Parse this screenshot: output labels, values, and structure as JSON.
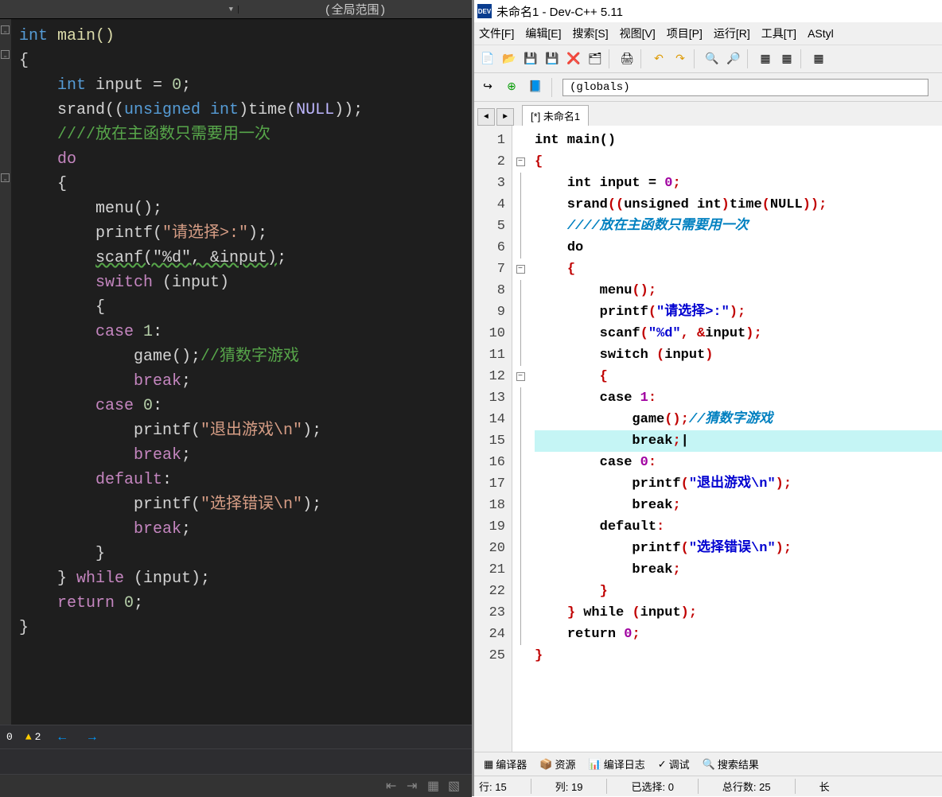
{
  "vs": {
    "top_scope": "(全局范围)",
    "warning_count": "2",
    "status_zero": "0",
    "code": [
      {
        "t": "int",
        "c": "k-type"
      },
      {
        "t": " main()",
        "c": "k-func"
      },
      {
        "nl": 1
      },
      {
        "t": "{",
        "c": "k-white"
      },
      {
        "nl": 1
      },
      {
        "t": "    ",
        "c": ""
      },
      {
        "t": "int",
        "c": "k-type"
      },
      {
        "t": " input = ",
        "c": "k-white"
      },
      {
        "t": "0",
        "c": "k-num"
      },
      {
        "t": ";",
        "c": "k-white"
      },
      {
        "nl": 1
      },
      {
        "t": "    srand((",
        "c": "k-white"
      },
      {
        "t": "unsigned int",
        "c": "k-type"
      },
      {
        "t": ")time(",
        "c": "k-white"
      },
      {
        "t": "NULL",
        "c": "k-macro"
      },
      {
        "t": "));",
        "c": "k-white"
      },
      {
        "nl": 1
      },
      {
        "t": "    ",
        "c": ""
      },
      {
        "t": "////放在主函数只需要用一次",
        "c": "k-comment"
      },
      {
        "nl": 1
      },
      {
        "t": "    ",
        "c": ""
      },
      {
        "t": "do",
        "c": "k-purple"
      },
      {
        "nl": 1
      },
      {
        "t": "    {",
        "c": "k-white"
      },
      {
        "nl": 1
      },
      {
        "t": "        menu();",
        "c": "k-white"
      },
      {
        "nl": 1
      },
      {
        "t": "        printf(",
        "c": "k-white"
      },
      {
        "t": "\"请选择>:\"",
        "c": "k-str"
      },
      {
        "t": ");",
        "c": "k-white"
      },
      {
        "nl": 1
      },
      {
        "t": "        ",
        "c": ""
      },
      {
        "t": "scanf(\"%d\", &input)",
        "c": "k-white wavy"
      },
      {
        "t": ";",
        "c": "k-white"
      },
      {
        "nl": 1
      },
      {
        "t": "        ",
        "c": ""
      },
      {
        "t": "switch",
        "c": "k-purple"
      },
      {
        "t": " (input)",
        "c": "k-white"
      },
      {
        "nl": 1
      },
      {
        "t": "        {",
        "c": "k-white"
      },
      {
        "nl": 1
      },
      {
        "t": "        ",
        "c": ""
      },
      {
        "t": "case",
        "c": "k-purple"
      },
      {
        "t": " ",
        "c": ""
      },
      {
        "t": "1",
        "c": "k-num"
      },
      {
        "t": ":",
        "c": "k-white"
      },
      {
        "nl": 1
      },
      {
        "t": "            game();",
        "c": "k-white"
      },
      {
        "t": "//猜数字游戏",
        "c": "k-comment"
      },
      {
        "nl": 1
      },
      {
        "t": "            ",
        "c": ""
      },
      {
        "t": "break",
        "c": "k-purple"
      },
      {
        "t": ";",
        "c": "k-white"
      },
      {
        "nl": 1
      },
      {
        "t": "        ",
        "c": ""
      },
      {
        "t": "case",
        "c": "k-purple"
      },
      {
        "t": " ",
        "c": ""
      },
      {
        "t": "0",
        "c": "k-num"
      },
      {
        "t": ":",
        "c": "k-white"
      },
      {
        "nl": 1
      },
      {
        "t": "            printf(",
        "c": "k-white"
      },
      {
        "t": "\"退出游戏\\n\"",
        "c": "k-str"
      },
      {
        "t": ");",
        "c": "k-white"
      },
      {
        "nl": 1
      },
      {
        "t": "            ",
        "c": ""
      },
      {
        "t": "break",
        "c": "k-purple"
      },
      {
        "t": ";",
        "c": "k-white"
      },
      {
        "nl": 1
      },
      {
        "t": "        ",
        "c": ""
      },
      {
        "t": "default",
        "c": "k-purple"
      },
      {
        "t": ":",
        "c": "k-white"
      },
      {
        "nl": 1
      },
      {
        "t": "            printf(",
        "c": "k-white"
      },
      {
        "t": "\"选择错误\\n\"",
        "c": "k-str"
      },
      {
        "t": ");",
        "c": "k-white"
      },
      {
        "nl": 1
      },
      {
        "t": "            ",
        "c": ""
      },
      {
        "t": "break",
        "c": "k-purple"
      },
      {
        "t": ";",
        "c": "k-white"
      },
      {
        "nl": 1
      },
      {
        "t": "        }",
        "c": "k-white"
      },
      {
        "nl": 1
      },
      {
        "t": "    } ",
        "c": "k-white"
      },
      {
        "t": "while",
        "c": "k-purple"
      },
      {
        "t": " (input);",
        "c": "k-white"
      },
      {
        "nl": 1
      },
      {
        "t": "    ",
        "c": ""
      },
      {
        "t": "return",
        "c": "k-purple"
      },
      {
        "t": " ",
        "c": ""
      },
      {
        "t": "0",
        "c": "k-num"
      },
      {
        "t": ";",
        "c": "k-white"
      },
      {
        "nl": 1
      },
      {
        "t": "}",
        "c": "k-white"
      }
    ]
  },
  "dc": {
    "title": "未命名1 - Dev-C++ 5.11",
    "title_icon": "DEV",
    "menu": [
      "文件[F]",
      "编辑[E]",
      "搜索[S]",
      "视图[V]",
      "项目[P]",
      "运行[R]",
      "工具[T]",
      "AStyl"
    ],
    "globals": "(globals)",
    "tab": "[*] 未命名1",
    "line_count": 25,
    "highlight_line": 15,
    "fold_lines": [
      2,
      7,
      12
    ],
    "code_lines": [
      [
        {
          "t": "int",
          "c": "d-kw"
        },
        {
          "t": " main()",
          "c": "d-func"
        }
      ],
      [
        {
          "t": "{",
          "c": "d-red"
        }
      ],
      [
        {
          "t": "    ",
          "c": ""
        },
        {
          "t": "int",
          "c": "d-kw"
        },
        {
          "t": " input = ",
          "c": ""
        },
        {
          "t": "0",
          "c": "d-num"
        },
        {
          "t": ";",
          "c": "d-red"
        }
      ],
      [
        {
          "t": "    srand",
          "c": ""
        },
        {
          "t": "((",
          "c": "d-red"
        },
        {
          "t": "unsigned int",
          "c": "d-kw"
        },
        {
          "t": ")",
          "c": "d-red"
        },
        {
          "t": "time",
          "c": ""
        },
        {
          "t": "(",
          "c": "d-red"
        },
        {
          "t": "NULL",
          "c": ""
        },
        {
          "t": "));",
          "c": "d-red"
        }
      ],
      [
        {
          "t": "    ",
          "c": ""
        },
        {
          "t": "////放在主函数只需要用一次",
          "c": "d-com"
        }
      ],
      [
        {
          "t": "    ",
          "c": ""
        },
        {
          "t": "do",
          "c": "d-kw"
        }
      ],
      [
        {
          "t": "    ",
          "c": ""
        },
        {
          "t": "{",
          "c": "d-red"
        }
      ],
      [
        {
          "t": "        menu",
          "c": ""
        },
        {
          "t": "();",
          "c": "d-red"
        }
      ],
      [
        {
          "t": "        printf",
          "c": ""
        },
        {
          "t": "(",
          "c": "d-red"
        },
        {
          "t": "\"请选择>:\"",
          "c": "d-str"
        },
        {
          "t": ");",
          "c": "d-red"
        }
      ],
      [
        {
          "t": "        scanf",
          "c": ""
        },
        {
          "t": "(",
          "c": "d-red"
        },
        {
          "t": "\"%d\"",
          "c": "d-str"
        },
        {
          "t": ", &",
          "c": "d-red"
        },
        {
          "t": "input",
          "c": ""
        },
        {
          "t": ");",
          "c": "d-red"
        }
      ],
      [
        {
          "t": "        ",
          "c": ""
        },
        {
          "t": "switch",
          "c": "d-kw"
        },
        {
          "t": " ",
          "c": ""
        },
        {
          "t": "(",
          "c": "d-red"
        },
        {
          "t": "input",
          "c": ""
        },
        {
          "t": ")",
          "c": "d-red"
        }
      ],
      [
        {
          "t": "        ",
          "c": ""
        },
        {
          "t": "{",
          "c": "d-red"
        }
      ],
      [
        {
          "t": "        ",
          "c": ""
        },
        {
          "t": "case",
          "c": "d-kw"
        },
        {
          "t": " ",
          "c": ""
        },
        {
          "t": "1",
          "c": "d-num"
        },
        {
          "t": ":",
          "c": "d-red"
        }
      ],
      [
        {
          "t": "            game",
          "c": ""
        },
        {
          "t": "();",
          "c": "d-red"
        },
        {
          "t": "//猜数字游戏",
          "c": "d-com"
        }
      ],
      [
        {
          "t": "            ",
          "c": ""
        },
        {
          "t": "break",
          "c": "d-kw"
        },
        {
          "t": ";",
          "c": "d-red"
        },
        {
          "t": "|",
          "c": ""
        }
      ],
      [
        {
          "t": "        ",
          "c": ""
        },
        {
          "t": "case",
          "c": "d-kw"
        },
        {
          "t": " ",
          "c": ""
        },
        {
          "t": "0",
          "c": "d-num"
        },
        {
          "t": ":",
          "c": "d-red"
        }
      ],
      [
        {
          "t": "            printf",
          "c": ""
        },
        {
          "t": "(",
          "c": "d-red"
        },
        {
          "t": "\"退出游戏\\n\"",
          "c": "d-str"
        },
        {
          "t": ");",
          "c": "d-red"
        }
      ],
      [
        {
          "t": "            ",
          "c": ""
        },
        {
          "t": "break",
          "c": "d-kw"
        },
        {
          "t": ";",
          "c": "d-red"
        }
      ],
      [
        {
          "t": "        ",
          "c": ""
        },
        {
          "t": "default",
          "c": "d-kw"
        },
        {
          "t": ":",
          "c": "d-red"
        }
      ],
      [
        {
          "t": "            printf",
          "c": ""
        },
        {
          "t": "(",
          "c": "d-red"
        },
        {
          "t": "\"选择错误\\n\"",
          "c": "d-str"
        },
        {
          "t": ");",
          "c": "d-red"
        }
      ],
      [
        {
          "t": "            ",
          "c": ""
        },
        {
          "t": "break",
          "c": "d-kw"
        },
        {
          "t": ";",
          "c": "d-red"
        }
      ],
      [
        {
          "t": "        ",
          "c": ""
        },
        {
          "t": "}",
          "c": "d-red"
        }
      ],
      [
        {
          "t": "    ",
          "c": ""
        },
        {
          "t": "}",
          "c": "d-red"
        },
        {
          "t": " ",
          "c": ""
        },
        {
          "t": "while",
          "c": "d-kw"
        },
        {
          "t": " ",
          "c": ""
        },
        {
          "t": "(",
          "c": "d-red"
        },
        {
          "t": "input",
          "c": ""
        },
        {
          "t": ");",
          "c": "d-red"
        }
      ],
      [
        {
          "t": "    ",
          "c": ""
        },
        {
          "t": "return",
          "c": "d-kw"
        },
        {
          "t": " ",
          "c": ""
        },
        {
          "t": "0",
          "c": "d-num"
        },
        {
          "t": ";",
          "c": "d-red"
        }
      ],
      [
        {
          "t": "}",
          "c": "d-red"
        }
      ]
    ],
    "bottom_tabs": [
      "编译器",
      "资源",
      "编译日志",
      "调试",
      "搜索结果"
    ],
    "status": {
      "line_label": "行:",
      "line": "15",
      "col_label": "列:",
      "col": "19",
      "sel_label": "已选择:",
      "sel": "0",
      "total_label": "总行数:",
      "total": "25",
      "len_label": "长"
    }
  }
}
